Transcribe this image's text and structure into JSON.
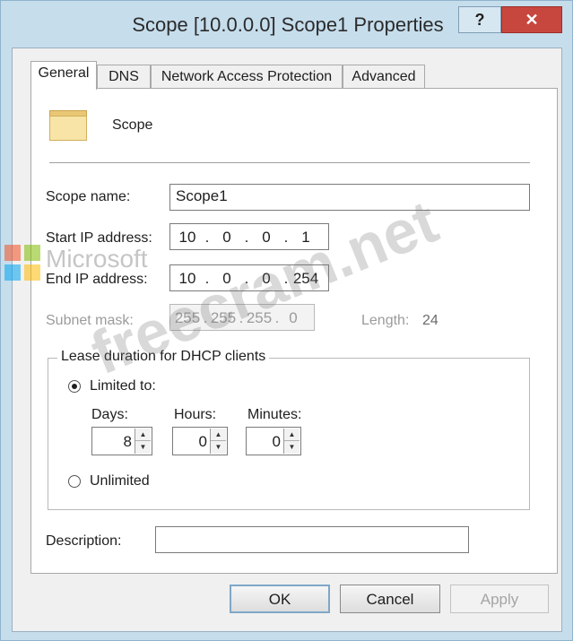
{
  "window": {
    "title": "Scope [10.0.0.0] Scope1 Properties",
    "help_label": "?",
    "close_label": "✕"
  },
  "tabs": [
    {
      "label": "General",
      "active": true
    },
    {
      "label": "DNS",
      "active": false
    },
    {
      "label": "Network Access Protection",
      "active": false
    },
    {
      "label": "Advanced",
      "active": false
    }
  ],
  "general": {
    "header_label": "Scope",
    "scope_name_label": "Scope name:",
    "scope_name_value": "Scope1",
    "start_ip_label": "Start IP address:",
    "start_ip": [
      "10",
      "0",
      "0",
      "1"
    ],
    "end_ip_label": "End IP address:",
    "end_ip": [
      "10",
      "0",
      "0",
      "254"
    ],
    "subnet_mask_label": "Subnet mask:",
    "subnet_mask": [
      "255",
      "255",
      "255",
      "0"
    ],
    "length_label": "Length:",
    "length_value": "24",
    "lease_group_label": "Lease duration for DHCP clients",
    "limited_label": "Limited to:",
    "days_label": "Days:",
    "days_value": "8",
    "hours_label": "Hours:",
    "hours_value": "0",
    "minutes_label": "Minutes:",
    "minutes_value": "0",
    "unlimited_label": "Unlimited",
    "description_label": "Description:",
    "description_value": ""
  },
  "buttons": {
    "ok": "OK",
    "cancel": "Cancel",
    "apply": "Apply"
  },
  "watermark": {
    "text": "freecram.net",
    "ms_text": "Microsoft"
  },
  "colors": {
    "close_button": "#c7473f",
    "window_frame": "#c6ddec"
  }
}
